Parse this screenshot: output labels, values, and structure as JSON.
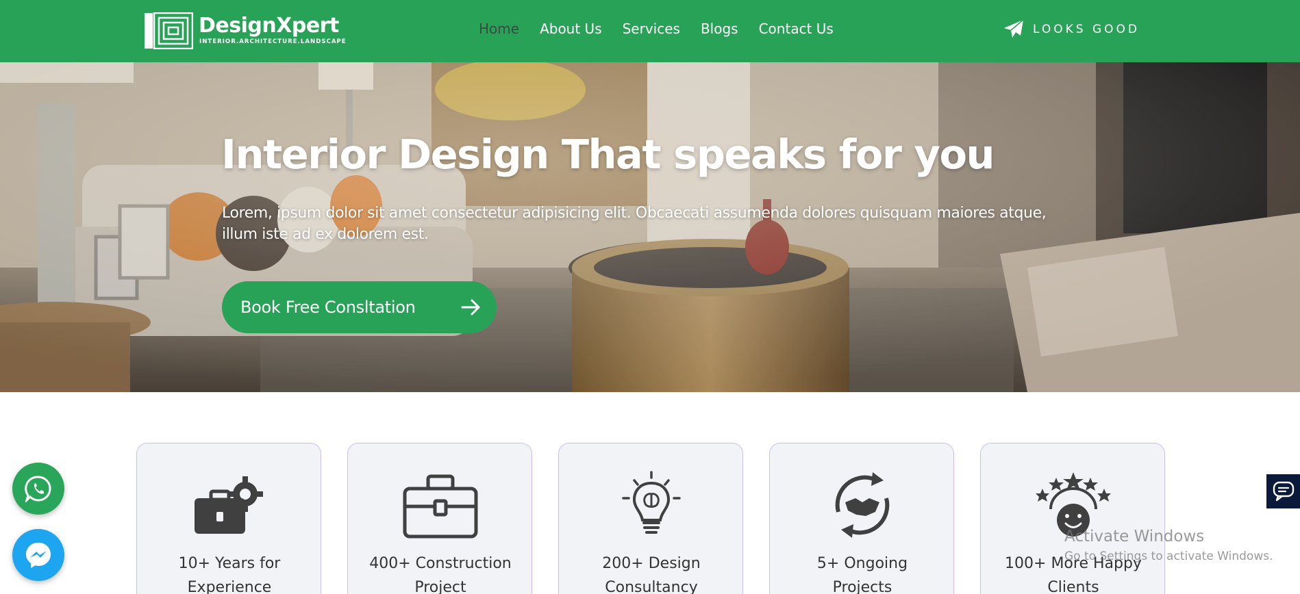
{
  "brand": {
    "name": "DesignXpert",
    "tagline": "INTERIOR.ARCHITECTURE.LANDSCAPE"
  },
  "nav": {
    "items": [
      {
        "label": "Home",
        "active": true
      },
      {
        "label": "About Us",
        "active": false
      },
      {
        "label": "Services",
        "active": false
      },
      {
        "label": "Blogs",
        "active": false
      },
      {
        "label": "Contact Us",
        "active": false
      }
    ],
    "cta_label": "LOOKS GOOD",
    "cta_icon": "paper-plane-icon"
  },
  "hero": {
    "title": "Interior Design That speaks for you",
    "description": "Lorem, ipsum dolor sit amet consectetur adipisicing elit. Obcaecati assumenda dolores quisquam maiores atque, illum iste ad ex dolorem est.",
    "button_label": "Book Free Consltation",
    "button_icon": "arrow-right-icon"
  },
  "stats": [
    {
      "label": "10+ Years for\nExperience",
      "icon": "briefcase-gear-icon"
    },
    {
      "label": "400+ Construction\nProject",
      "icon": "briefcase-icon"
    },
    {
      "label": "200+ Design\nConsultancy",
      "icon": "lightbulb-brain-icon"
    },
    {
      "label": "5+ Ongoing\nProjects",
      "icon": "handshake-cycle-icon"
    },
    {
      "label": "100+ More Happy\nClients",
      "icon": "happy-face-stars-icon"
    }
  ],
  "widgets": {
    "whatsapp_icon": "whatsapp-icon",
    "messenger_icon": "messenger-icon",
    "chat_icon": "chat-icon"
  },
  "watermark": {
    "line1": "Activate Windows",
    "line2": "Go to Settings to activate Windows."
  },
  "colors": {
    "brand_green": "#28a257",
    "nav_active": "#3b4a40",
    "card_border": "#cdbff5",
    "card_bg": "#f2f3f6",
    "messenger_blue": "#1ea5f0",
    "chat_navy": "#0b1a3a"
  }
}
